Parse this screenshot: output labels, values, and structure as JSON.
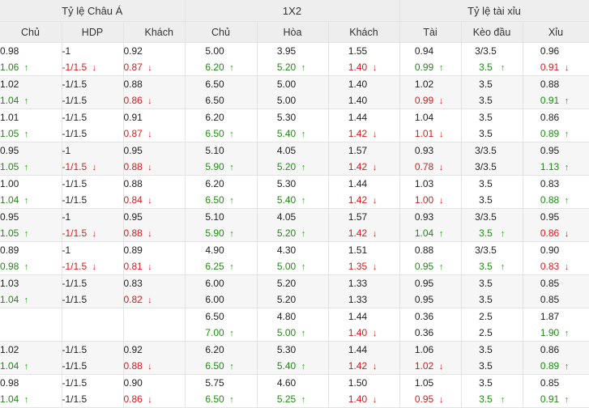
{
  "header": {
    "asian": "Tỷ lệ Châu Á",
    "x12": "1X2",
    "ou": "Tỷ lệ tài xỉu"
  },
  "columns": [
    "Chủ",
    "HDP",
    "Khách",
    "Chủ",
    "Hòa",
    "Khách",
    "Tài",
    "Kèo đầu",
    "Xỉu"
  ],
  "rows": [
    {
      "cells": [
        [
          "0.98",
          "1.06",
          "up"
        ],
        [
          "-1",
          "-1/1.5",
          "down"
        ],
        [
          "0.92",
          "0.87",
          "down"
        ],
        [
          "5.00",
          "6.20",
          "up"
        ],
        [
          "3.95",
          "5.20",
          "up"
        ],
        [
          "1.55",
          "1.40",
          "down"
        ],
        [
          "0.94",
          "0.99",
          "up"
        ],
        [
          "3/3.5",
          "3.5",
          "up"
        ],
        [
          "0.96",
          "0.91",
          "down"
        ]
      ]
    },
    {
      "cells": [
        [
          "1.02",
          "1.04",
          "up"
        ],
        [
          "-1/1.5",
          "-1/1.5",
          ""
        ],
        [
          "0.88",
          "0.86",
          "down"
        ],
        [
          "6.50",
          "6.50",
          ""
        ],
        [
          "5.00",
          "5.00",
          ""
        ],
        [
          "1.40",
          "1.40",
          ""
        ],
        [
          "1.02",
          "0.99",
          "down"
        ],
        [
          "3.5",
          "3.5",
          ""
        ],
        [
          "0.88",
          "0.91",
          "up"
        ]
      ]
    },
    {
      "cells": [
        [
          "1.01",
          "1.05",
          "up"
        ],
        [
          "-1/1.5",
          "-1/1.5",
          ""
        ],
        [
          "0.91",
          "0.87",
          "down"
        ],
        [
          "6.20",
          "6.50",
          "up"
        ],
        [
          "5.30",
          "5.40",
          "up"
        ],
        [
          "1.44",
          "1.42",
          "down"
        ],
        [
          "1.04",
          "1.01",
          "down"
        ],
        [
          "3.5",
          "3.5",
          ""
        ],
        [
          "0.86",
          "0.89",
          "up"
        ]
      ]
    },
    {
      "cells": [
        [
          "0.95",
          "1.05",
          "up"
        ],
        [
          "-1",
          "-1/1.5",
          "down"
        ],
        [
          "0.95",
          "0.88",
          "down"
        ],
        [
          "5.10",
          "5.90",
          "up"
        ],
        [
          "4.05",
          "5.20",
          "up"
        ],
        [
          "1.57",
          "1.42",
          "down"
        ],
        [
          "0.93",
          "0.78",
          "down"
        ],
        [
          "3/3.5",
          "3/3.5",
          ""
        ],
        [
          "0.95",
          "1.13",
          "up"
        ]
      ]
    },
    {
      "cells": [
        [
          "1.00",
          "1.04",
          "up"
        ],
        [
          "-1/1.5",
          "-1/1.5",
          ""
        ],
        [
          "0.88",
          "0.84",
          "down"
        ],
        [
          "6.20",
          "6.50",
          "up"
        ],
        [
          "5.30",
          "5.40",
          "up"
        ],
        [
          "1.44",
          "1.42",
          "down"
        ],
        [
          "1.03",
          "1.00",
          "down"
        ],
        [
          "3.5",
          "3.5",
          ""
        ],
        [
          "0.83",
          "0.88",
          "up"
        ]
      ]
    },
    {
      "cells": [
        [
          "0.95",
          "1.05",
          "up"
        ],
        [
          "-1",
          "-1/1.5",
          "down"
        ],
        [
          "0.95",
          "0.88",
          "down"
        ],
        [
          "5.10",
          "5.90",
          "up"
        ],
        [
          "4.05",
          "5.20",
          "up"
        ],
        [
          "1.57",
          "1.42",
          "down"
        ],
        [
          "0.93",
          "1.04",
          "up"
        ],
        [
          "3/3.5",
          "3.5",
          "up"
        ],
        [
          "0.95",
          "0.86",
          "down"
        ]
      ]
    },
    {
      "cells": [
        [
          "0.89",
          "0.98",
          "up"
        ],
        [
          "-1",
          "-1/1.5",
          "down"
        ],
        [
          "0.89",
          "0.81",
          "down"
        ],
        [
          "4.90",
          "6.25",
          "up"
        ],
        [
          "4.30",
          "5.00",
          "up"
        ],
        [
          "1.51",
          "1.35",
          "down"
        ],
        [
          "0.88",
          "0.95",
          "up"
        ],
        [
          "3/3.5",
          "3.5",
          "up"
        ],
        [
          "0.90",
          "0.83",
          "down"
        ]
      ]
    },
    {
      "cells": [
        [
          "1.03",
          "1.04",
          "up"
        ],
        [
          "-1/1.5",
          "-1/1.5",
          ""
        ],
        [
          "0.83",
          "0.82",
          "down"
        ],
        [
          "6.00",
          "6.00",
          ""
        ],
        [
          "5.20",
          "5.20",
          ""
        ],
        [
          "1.33",
          "1.33",
          ""
        ],
        [
          "0.95",
          "0.95",
          ""
        ],
        [
          "3.5",
          "3.5",
          ""
        ],
        [
          "0.85",
          "0.85",
          ""
        ]
      ]
    },
    {
      "cells": [
        [
          "",
          "",
          ""
        ],
        [
          "",
          "",
          ""
        ],
        [
          "",
          "",
          ""
        ],
        [
          "6.50",
          "7.00",
          "up"
        ],
        [
          "4.80",
          "5.00",
          "up"
        ],
        [
          "1.44",
          "1.40",
          "down"
        ],
        [
          "0.36",
          "0.36",
          ""
        ],
        [
          "2.5",
          "2.5",
          ""
        ],
        [
          "1.87",
          "1.90",
          "up"
        ]
      ]
    },
    {
      "cells": [
        [
          "1.02",
          "1.04",
          "up"
        ],
        [
          "-1/1.5",
          "-1/1.5",
          ""
        ],
        [
          "0.92",
          "0.88",
          "down"
        ],
        [
          "6.20",
          "6.50",
          "up"
        ],
        [
          "5.30",
          "5.40",
          "up"
        ],
        [
          "1.44",
          "1.42",
          "down"
        ],
        [
          "1.06",
          "1.02",
          "down"
        ],
        [
          "3.5",
          "3.5",
          ""
        ],
        [
          "0.86",
          "0.89",
          "up"
        ]
      ]
    },
    {
      "cells": [
        [
          "0.98",
          "1.04",
          "up"
        ],
        [
          "-1/1.5",
          "-1/1.5",
          ""
        ],
        [
          "0.90",
          "0.86",
          "down"
        ],
        [
          "5.75",
          "6.50",
          "up"
        ],
        [
          "4.60",
          "5.25",
          "up"
        ],
        [
          "1.50",
          "1.40",
          "down"
        ],
        [
          "1.05",
          "0.95",
          "down"
        ],
        [
          "3.5",
          "3.5",
          "up"
        ],
        [
          "0.85",
          "0.91",
          "up"
        ]
      ]
    }
  ]
}
